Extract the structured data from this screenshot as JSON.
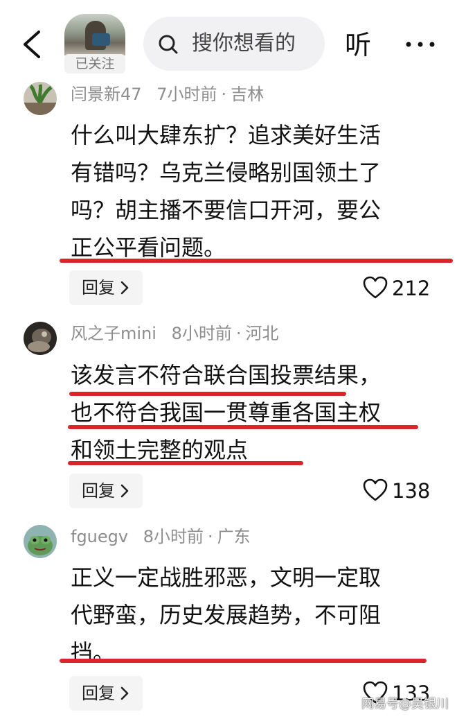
{
  "header": {
    "back_icon": "chevron-left-icon",
    "follow_label": "已关注",
    "search_placeholder": "搜你想看的",
    "listen_label": "听",
    "more_icon": "more-dots-icon"
  },
  "comments": [
    {
      "user": "闫景新47",
      "time": "7小时前",
      "location": "吉林",
      "lines": [
        "什么叫大肆东扩？追求美好生活",
        "有错吗？乌克兰侵略别国领土了",
        "吗？胡主播不要信口开河，要公",
        "正公平看问题。"
      ],
      "reply_label": "回复",
      "likes": "212"
    },
    {
      "user": "风之子mini",
      "time": "8小时前",
      "location": "河北",
      "lines": [
        "该发言不符合联合国投票结果，",
        "也不符合我国一贯尊重各国主权",
        "和领土完整的观点"
      ],
      "reply_label": "回复",
      "likes": "138"
    },
    {
      "user": "fguegv",
      "time": "8小时前",
      "location": "广东",
      "lines": [
        "正义一定战胜邪恶，文明一定取",
        "代野蛮，历史发展趋势，不可阻",
        "挡。"
      ],
      "reply_label": "回复",
      "likes": "133"
    }
  ],
  "watermark": "网易号@吴银川",
  "colors": {
    "underline": "#d9252c",
    "meta": "#8d8d8d"
  }
}
